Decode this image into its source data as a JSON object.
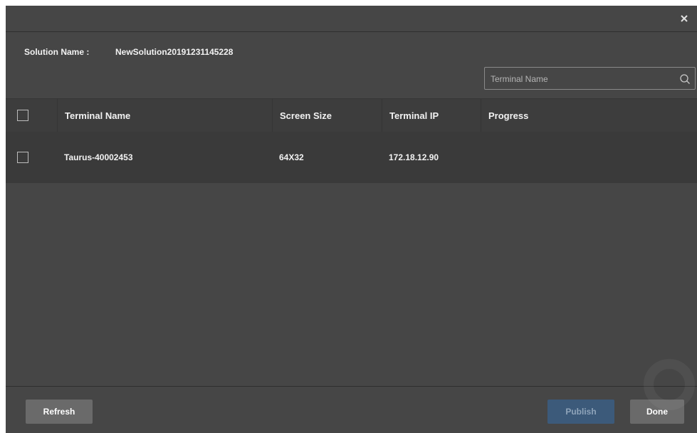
{
  "dialog": {
    "solution_label": "Solution Name :",
    "solution_value": "NewSolution20191231145228"
  },
  "search": {
    "placeholder": "Terminal Name",
    "value": ""
  },
  "table": {
    "columns": [
      "Terminal Name",
      "Screen Size",
      "Terminal IP",
      "Progress"
    ],
    "rows": [
      {
        "terminal_name": "Taurus-40002453",
        "screen_size": "64X32",
        "terminal_ip": "172.18.12.90",
        "progress": ""
      }
    ]
  },
  "footer": {
    "refresh_label": "Refresh",
    "publish_label": "Publish",
    "done_label": "Done"
  },
  "icons": {
    "close": "close-icon",
    "search": "search-icon",
    "checkbox": "checkbox-unchecked"
  },
  "colors": {
    "background": "#464646",
    "header": "#3d3d3d",
    "row": "#3a3a3a",
    "button": "#6a6a6a",
    "publish_disabled": "#3c5a7a"
  }
}
